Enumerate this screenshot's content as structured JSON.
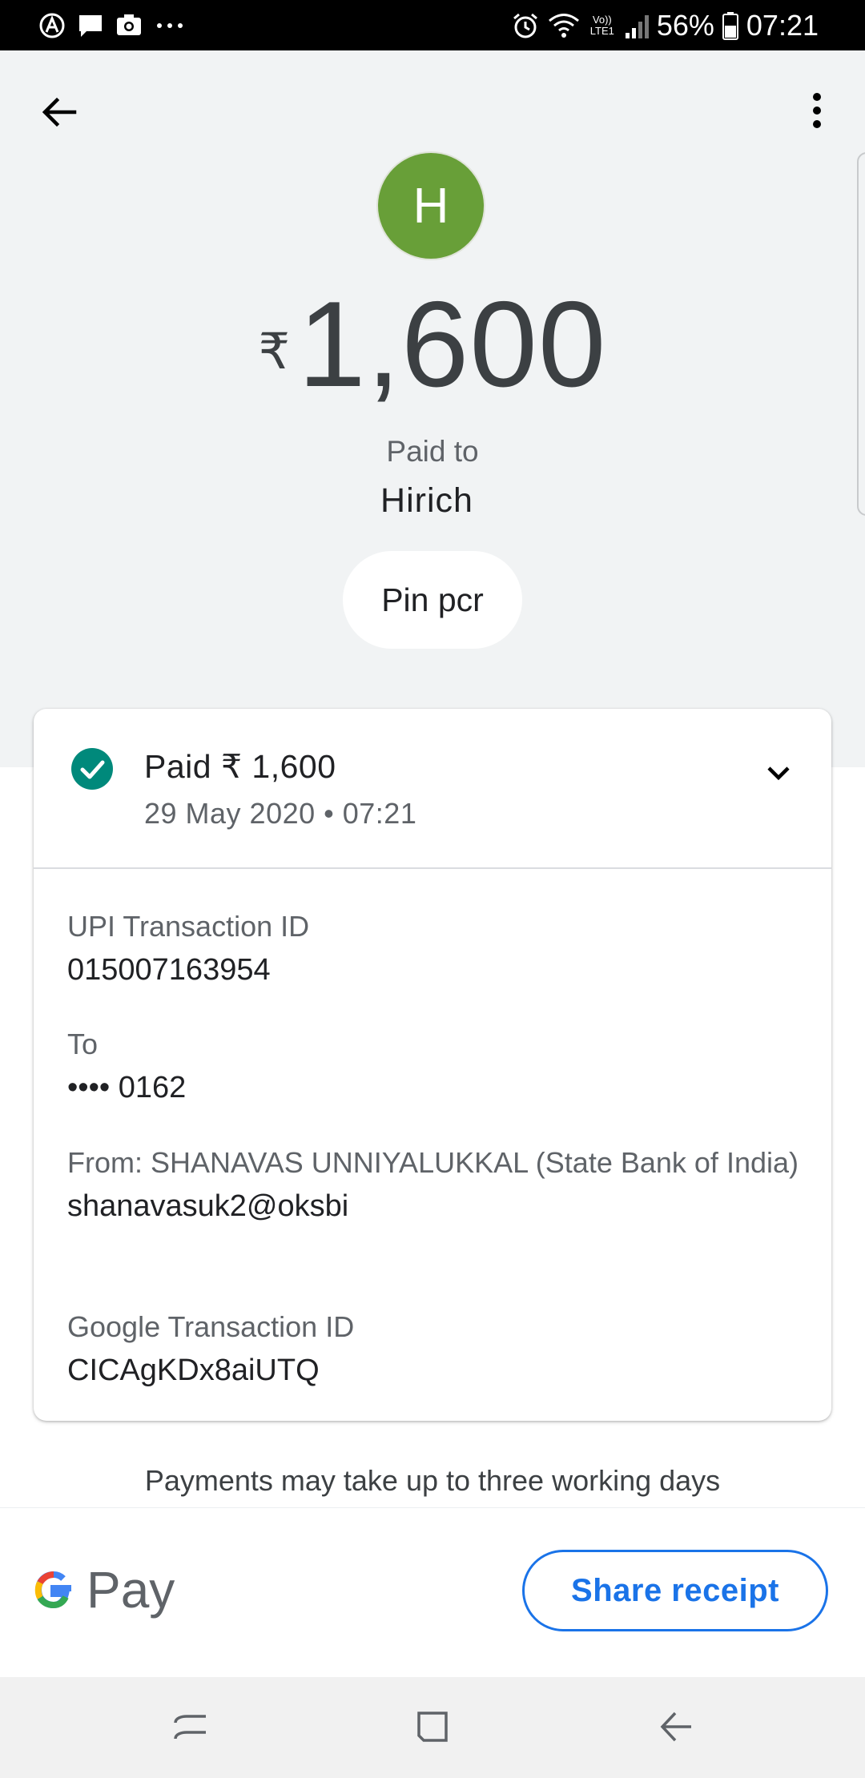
{
  "status_bar": {
    "battery": "56%",
    "time": "07:21",
    "network_label": "Vo)) LTE1"
  },
  "header": {
    "avatar_initial": "H",
    "currency": "₹",
    "amount": "1,600",
    "paid_to_label": "Paid to",
    "payee_name": "Hirich",
    "note": "Pin pcr"
  },
  "card": {
    "status_title": "Paid ₹ 1,600",
    "datetime": "29 May 2020 • 07:21",
    "details": [
      {
        "label": "UPI Transaction ID",
        "value": "015007163954"
      },
      {
        "label": "To",
        "value": "•••• 0162"
      },
      {
        "label": "From: SHANAVAS  UNNIYALUKKAL (State Bank of India)",
        "value": "shanavasuk2@oksbi"
      },
      {
        "label": "Google Transaction ID",
        "value": "CICAgKDx8aiUTQ"
      }
    ]
  },
  "footer": {
    "note": "Payments may take up to three working days",
    "brand_word": "Pay",
    "share_label": "Share receipt"
  },
  "colors": {
    "accent": "#1a73e8",
    "success": "#00897b",
    "avatar": "#689f38",
    "top_background": "#f1f3f4"
  },
  "icons": {
    "back": "arrow-left-icon",
    "menu": "more-vert-icon",
    "status": "check-circle-icon",
    "expand": "chevron-down-icon"
  }
}
